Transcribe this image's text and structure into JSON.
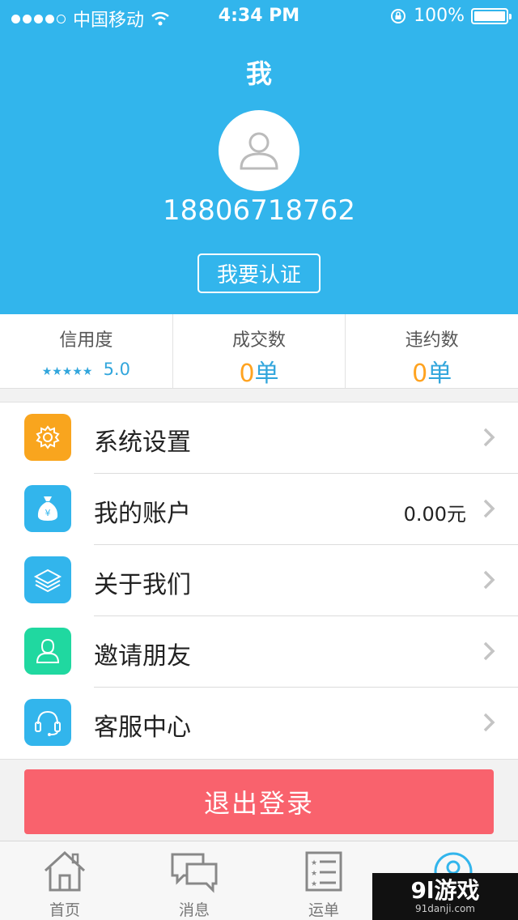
{
  "status_bar": {
    "carrier": "中国移动",
    "time": "4:34 PM",
    "battery": "100%"
  },
  "header": {
    "title": "我",
    "phone": "18806718762",
    "certify_label": "我要认证"
  },
  "stats": {
    "credit": {
      "label": "信用度",
      "rating": "5.0",
      "stars": "★★★★★"
    },
    "deals": {
      "label": "成交数",
      "count": "0",
      "unit": "单"
    },
    "breaches": {
      "label": "违约数",
      "count": "0",
      "unit": "单"
    }
  },
  "menu": [
    {
      "label": "系统设置",
      "value": "",
      "icon": "gear-icon",
      "color": "#f9a51e"
    },
    {
      "label": "我的账户",
      "value": "0.00元",
      "icon": "money-bag-icon",
      "color": "#32b5ec"
    },
    {
      "label": "关于我们",
      "value": "",
      "icon": "layers-icon",
      "color": "#32b5ec"
    },
    {
      "label": "邀请朋友",
      "value": "",
      "icon": "person-icon",
      "color": "#20d8a0"
    },
    {
      "label": "客服中心",
      "value": "",
      "icon": "headset-icon",
      "color": "#32b5ec"
    }
  ],
  "logout_label": "退出登录",
  "tabs": [
    {
      "label": "首页",
      "icon": "home-icon"
    },
    {
      "label": "消息",
      "icon": "chat-icon"
    },
    {
      "label": "运单",
      "icon": "list-icon"
    },
    {
      "label": "",
      "icon": "profile-icon"
    }
  ],
  "watermark": {
    "line1": "9l游戏",
    "line2": "91danji.com"
  },
  "colors": {
    "primary": "#32b5ec",
    "accent": "#ffa320",
    "danger": "#f9626d"
  }
}
